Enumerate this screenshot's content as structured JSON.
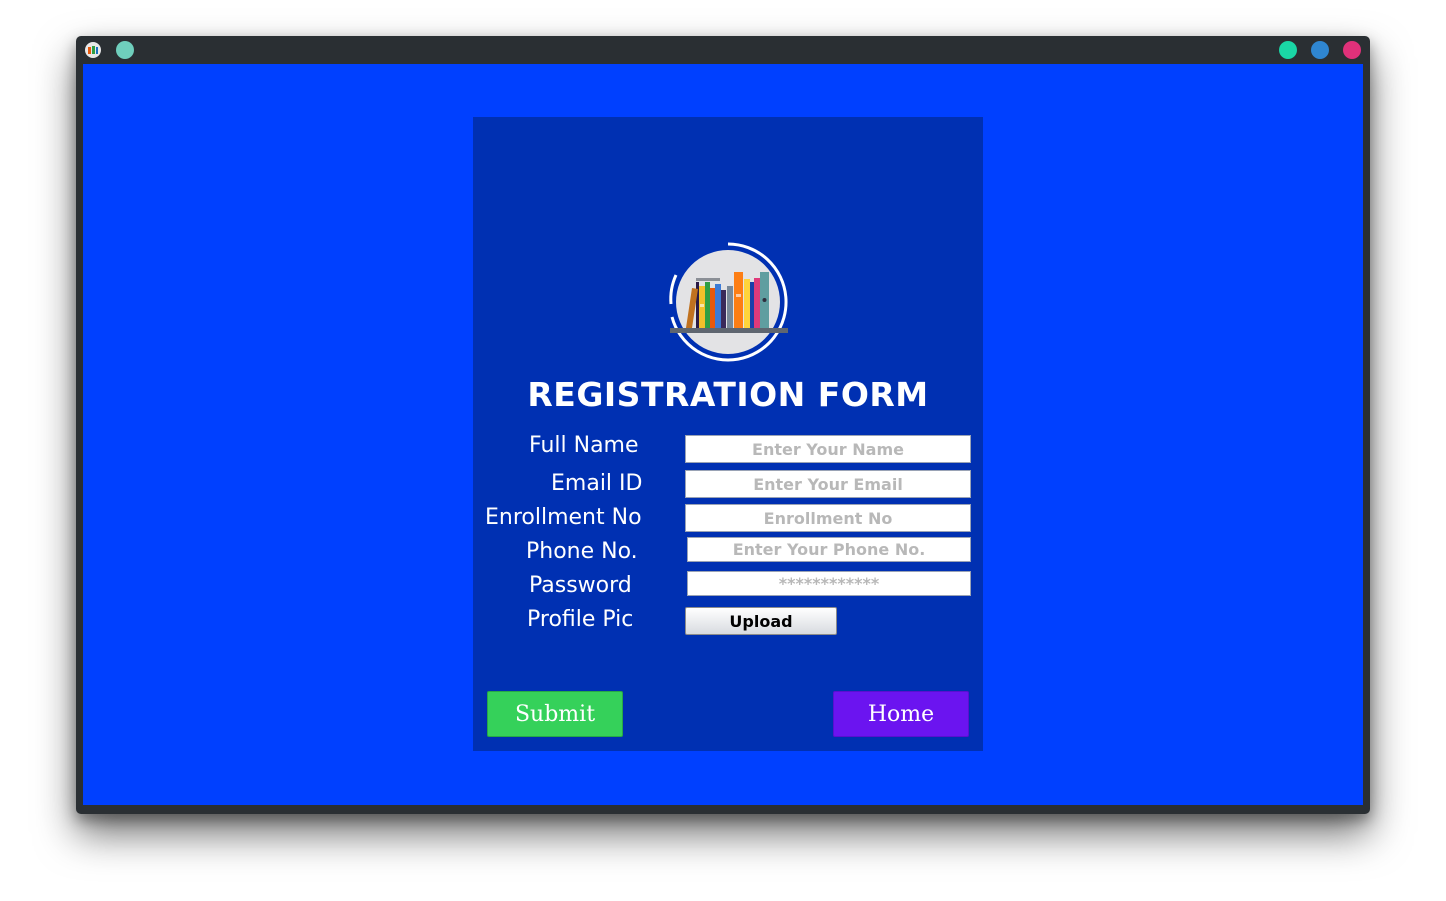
{
  "window": {
    "accent_colors": {
      "title_dot": "#6fcfbd",
      "minimize": "#1ad6a6",
      "maximize": "#2f86d1",
      "close": "#e0317a"
    },
    "app_icon": "books-app-icon"
  },
  "colors": {
    "background": "#0040ff",
    "panel": "#0030b2",
    "submit": "#35d15a",
    "home": "#6b14f0"
  },
  "form": {
    "logo": "bookshelf-logo",
    "title": "REGISTRATION FORM",
    "fields": {
      "full_name": {
        "label": "Full Name",
        "placeholder": "Enter Your Name",
        "value": ""
      },
      "email": {
        "label": "Email ID",
        "placeholder": "Enter Your Email",
        "value": ""
      },
      "enrollment": {
        "label": "Enrollment No",
        "placeholder": "Enrollment No",
        "value": ""
      },
      "phone": {
        "label": "Phone No.",
        "placeholder": "Enter Your Phone No.",
        "value": ""
      },
      "password": {
        "label": "Password",
        "placeholder": "",
        "value": "************"
      },
      "profile_pic": {
        "label": "Profile Pic"
      }
    },
    "upload_label": "Upload",
    "submit_label": "Submit",
    "home_label": "Home"
  }
}
